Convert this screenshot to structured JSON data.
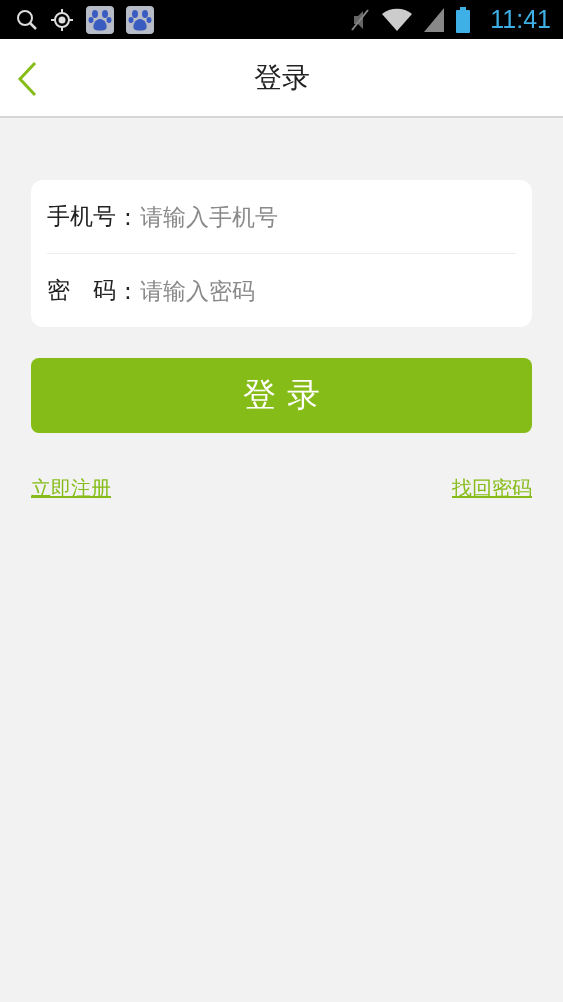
{
  "status_bar": {
    "time": "11:41"
  },
  "header": {
    "title": "登录"
  },
  "form": {
    "fields": [
      {
        "label": "手机号",
        "separator": ":",
        "placeholder": "请输入手机号"
      },
      {
        "label": "密　码",
        "separator": ":",
        "placeholder": "请输入密码"
      }
    ]
  },
  "login_button": {
    "label": "登 录"
  },
  "links": [
    {
      "label": "立即注册"
    },
    {
      "label": "找回密码"
    }
  ]
}
